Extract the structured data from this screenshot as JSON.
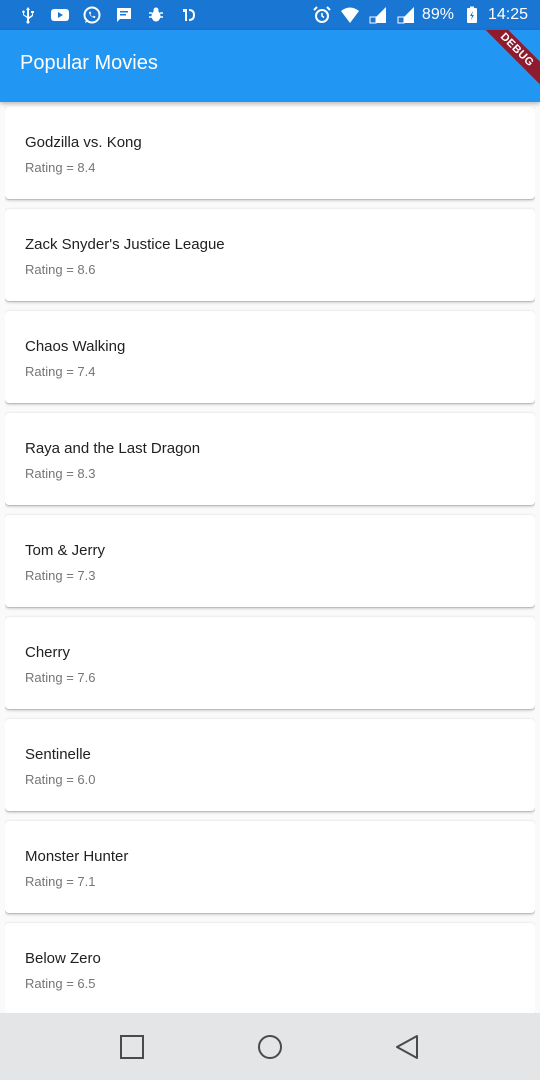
{
  "status_bar": {
    "battery": "89%",
    "time": "14:25",
    "icons_left": [
      "usb-icon",
      "youtube-icon",
      "whatsapp-icon",
      "message-icon",
      "bug-icon",
      "app-icon"
    ],
    "icons_right": [
      "alarm-icon",
      "wifi-icon",
      "signal-icon",
      "signal-icon",
      "battery-icon"
    ]
  },
  "app_bar": {
    "title": "Popular Movies",
    "background": "#2196F3"
  },
  "debug_banner": "DEBUG",
  "movies": [
    {
      "title": "Godzilla vs. Kong",
      "rating": "Rating = 8.4"
    },
    {
      "title": "Zack Snyder's Justice League",
      "rating": "Rating = 8.6"
    },
    {
      "title": "Chaos Walking",
      "rating": "Rating = 7.4"
    },
    {
      "title": "Raya and the Last Dragon",
      "rating": "Rating = 8.3"
    },
    {
      "title": "Tom & Jerry",
      "rating": "Rating = 7.3"
    },
    {
      "title": "Cherry",
      "rating": "Rating = 7.6"
    },
    {
      "title": "Sentinelle",
      "rating": "Rating = 6.0"
    },
    {
      "title": "Monster Hunter",
      "rating": "Rating = 7.1"
    },
    {
      "title": "Below Zero",
      "rating": "Rating = 6.5"
    }
  ],
  "nav_bar": {
    "buttons": [
      "recent-apps-icon",
      "home-icon",
      "back-icon"
    ]
  }
}
